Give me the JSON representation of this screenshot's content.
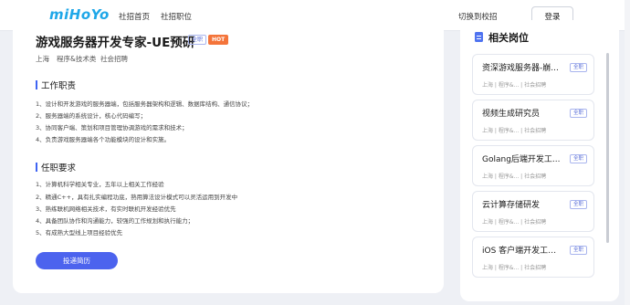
{
  "header": {
    "logo": "miHoYo",
    "nav": [
      "社招首页",
      "社招职位"
    ],
    "switch_campus": "切换到校招",
    "login": "登录"
  },
  "job": {
    "title": "游戏服务器开发专家-UE预研",
    "tag_fulltime": "全职",
    "tag_hot": "HOT",
    "location": "上海",
    "category": "程序&技术类",
    "type": "社会招聘"
  },
  "duties": {
    "title": "工作职责",
    "items": [
      "1、设计和开发游戏的服务器端，包括服务器架构和逻辑、数据库结构、通信协议；",
      "2、服务器端的系统设计，核心代码编写；",
      "3、协同客户端、策划和项目管理协调游戏的需求和技术；",
      "4、负责游戏服务器端各个功能模块的设计和实施。"
    ]
  },
  "requirements": {
    "title": "任职要求",
    "items": [
      "1、计算机科学相关专业，五年以上相关工作经验",
      "2、精通C++，具有扎实编程功底，熟用算法设计模式可以灵活运用到开发中",
      "3、熟练联机网络相关技术，有实时联机开发经验优先",
      "4、具备团队协作和沟通能力，较强的工作规划和执行能力；",
      "5、有成熟大型线上项目经验优先"
    ]
  },
  "apply_label": "投递简历",
  "related": {
    "title": "相关岗位",
    "items": [
      {
        "name": "资深游戏服务器-崩...",
        "tag": "全职",
        "meta": "上海 | 程序&... | 社会招聘"
      },
      {
        "name": "视频生成研究员",
        "tag": "全职",
        "meta": "上海 | 程序&... | 社会招聘"
      },
      {
        "name": "Golang后端开发工...",
        "tag": "全职",
        "meta": "上海 | 程序&... | 社会招聘"
      },
      {
        "name": "云计算存储研发",
        "tag": "全职",
        "meta": "上海 | 程序&... | 社会招聘"
      },
      {
        "name": "iOS 客户端开发工程...",
        "tag": "全职",
        "meta": "上海 | 程序&... | 社会招聘"
      }
    ]
  },
  "colors": {
    "accent": "#4c63ee",
    "hot": "#f4743a",
    "logo": "#1fa7e8",
    "background": "#eef0f5"
  }
}
